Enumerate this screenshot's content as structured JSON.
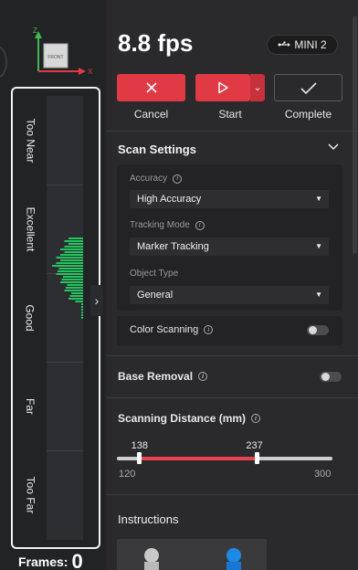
{
  "left_panel": {
    "axis_labels": {
      "z": "Z",
      "x": "X",
      "cube_face": "FRONT"
    },
    "bands": [
      {
        "label": "Too Near"
      },
      {
        "label": "Excellent"
      },
      {
        "label": "Good"
      },
      {
        "label": "Far"
      },
      {
        "label": "Too Far"
      }
    ],
    "collapse_icon": "chevron-right-icon",
    "collapse_glyph": "›",
    "frames_label": "Frames:",
    "frames_value": "0",
    "histogram_color": "#22c55e"
  },
  "header": {
    "fps": "8.8 fps",
    "device": {
      "icon": "usb-icon",
      "label": "MINI 2"
    }
  },
  "actions": {
    "cancel_label": "Cancel",
    "start_label": "Start",
    "complete_label": "Complete",
    "start_dropdown_glyph": "⌄"
  },
  "scan_settings": {
    "title": "Scan Settings",
    "accuracy": {
      "label": "Accuracy",
      "value": "High Accuracy"
    },
    "tracking_mode": {
      "label": "Tracking Mode",
      "value": "Marker Tracking"
    },
    "object_type": {
      "label": "Object Type",
      "value": "General"
    },
    "color_scanning": {
      "label": "Color Scanning",
      "on": false
    }
  },
  "base_removal": {
    "label": "Base Removal",
    "on": false
  },
  "scanning_distance": {
    "title": "Scanning Distance (mm)",
    "min": 120,
    "max": 300,
    "low": 138,
    "high": 237,
    "min_label": "120",
    "max_label": "300",
    "low_label": "138",
    "high_label": "237"
  },
  "instructions": {
    "title": "Instructions"
  },
  "colors": {
    "accent": "#e03a44",
    "panel": "#2a2a2c"
  }
}
